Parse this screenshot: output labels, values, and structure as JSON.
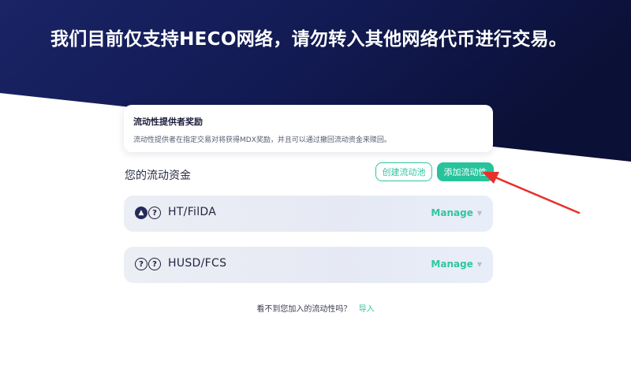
{
  "banner": {
    "headline": "我们目前仅支持HECO网络，请勿转入其他网络代币进行交易。"
  },
  "info_card": {
    "title": "流动性提供者奖励",
    "description": "流动性提供者在指定交易对将获得MDX奖励，并且可以通过撤回流动资金来赎回。"
  },
  "liquidity": {
    "section_title": "您的流动资金",
    "create_pool_label": "创建流动池",
    "add_liquidity_label": "添加流动性",
    "pairs": [
      {
        "name": "HT/FilDA",
        "manage_label": "Manage",
        "icons": [
          "ht-coin-icon",
          "unknown-token-icon"
        ]
      },
      {
        "name": "HUSD/FCS",
        "manage_label": "Manage",
        "icons": [
          "unknown-token-icon",
          "unknown-token-icon"
        ]
      }
    ]
  },
  "footer": {
    "question": "看不到您加入的流动性吗？",
    "import_label": "导入"
  },
  "colors": {
    "banner_dark": "#0f1548",
    "accent_green": "#27c39b",
    "annotation_arrow": "#e8302a"
  }
}
